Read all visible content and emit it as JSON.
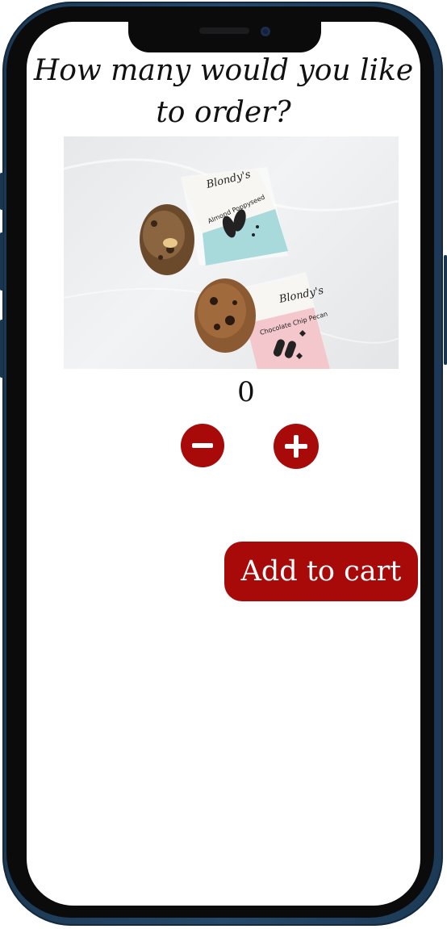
{
  "heading": "How many would you like to order?",
  "product_image": {
    "alt": "Blondy's cookies",
    "package_top": {
      "brand": "Blondy's",
      "flavor": "Almond Poppyseed"
    },
    "package_bottom": {
      "brand": "Blondy's",
      "flavor": "Chocolate Chip Pecan"
    }
  },
  "quantity": "0",
  "controls": {
    "decrement_icon": "minus-circle-icon",
    "increment_icon": "plus-circle-icon"
  },
  "add_to_cart_label": "Add to cart",
  "colors": {
    "accent": "#a80a0a",
    "phone_frame": "#1f4262",
    "bezel": "#0b0b0c"
  }
}
